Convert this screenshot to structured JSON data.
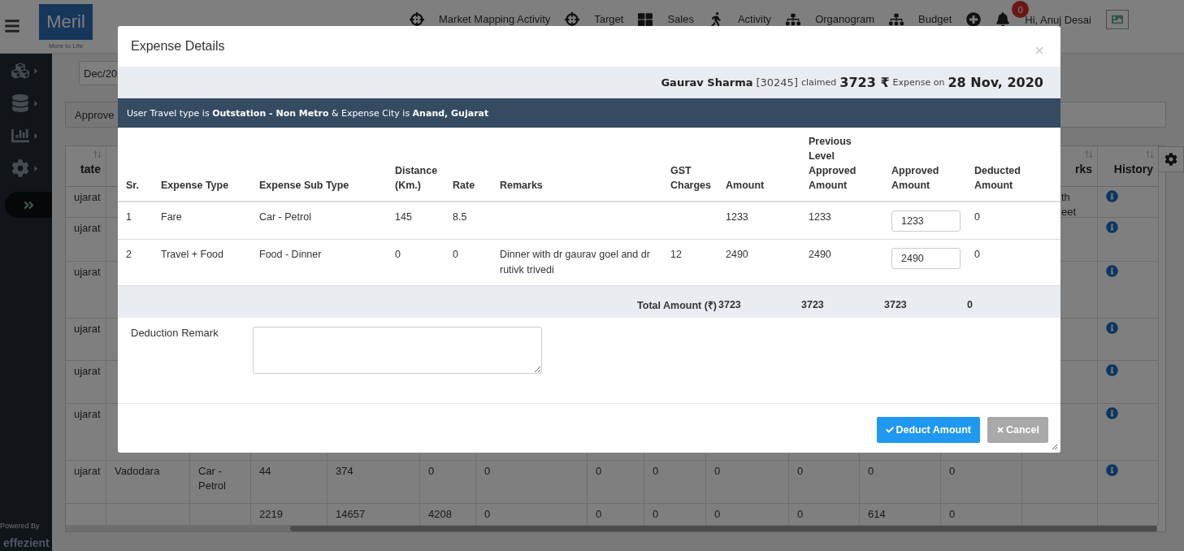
{
  "header": {
    "logo": "Meril",
    "tagline": "More to Life",
    "nav": [
      {
        "label": "Market Mapping Activity",
        "kind": "target"
      },
      {
        "label": "Target",
        "kind": "target"
      },
      {
        "label": "Sales",
        "kind": "sales"
      },
      {
        "label": "Activity",
        "kind": "activity"
      },
      {
        "label": "Organogram",
        "kind": "organogram"
      },
      {
        "label": "Budget",
        "kind": "organogram"
      }
    ],
    "notification_count": "0",
    "greeting": "Hi, Anuj Desai"
  },
  "sidebar": {
    "items": [
      {
        "kind": "cubes"
      },
      {
        "kind": "database"
      },
      {
        "kind": "chart"
      },
      {
        "kind": "settings"
      },
      {
        "kind": "expand"
      }
    ],
    "powered_by": "Powered By",
    "brand": "effezient"
  },
  "filter": {
    "period": "Dec/20"
  },
  "action_tab": "Approve",
  "background_table": {
    "headers": {
      "state": "tate",
      "remarks": "rks",
      "history": "History"
    },
    "rows": [
      {
        "kind": "partial",
        "state": "ujarat",
        "remarks": "th eet"
      },
      {
        "kind": "partial",
        "state": "ujarat"
      },
      {
        "kind": "partial",
        "state": "ujarat"
      },
      {
        "kind": "partial",
        "state": "ujarat"
      },
      {
        "kind": "partial",
        "state": "ujarat"
      },
      {
        "kind": "partial",
        "state": "ujarat"
      },
      {
        "kind": "entry",
        "cells": [
          "ujarat",
          "Vadodara",
          "Car - Petrol",
          "44",
          "374",
          "0",
          "0",
          "0",
          "0",
          "0",
          "0",
          "0",
          "0"
        ]
      },
      {
        "kind": "total",
        "values": [
          "2219",
          "14657",
          "4208",
          "0",
          "0",
          "0",
          "0",
          "0",
          "614",
          "0"
        ]
      }
    ]
  },
  "modal": {
    "title": "Expense Details",
    "close": "×",
    "summary": {
      "claimant": "Gaurav Sharma",
      "employee_id": "[30245]",
      "claimed_label": "claimed",
      "amount": "3723 ₹",
      "expense_label": "Expense on",
      "date": "28 Nov, 2020"
    },
    "travel_info": "User Travel type is **Outstation - Non Metro** & Expense City is **Anand, Gujarat**",
    "columns": [
      "Sr.",
      "Expense Type",
      "Expense Sub Type",
      "Distance (Km.)",
      "Rate",
      "Remarks",
      "GST Charges",
      "Amount",
      "Previous Level Approved Amount",
      "Approved Amount",
      "Deducted Amount"
    ],
    "rows": [
      {
        "sr": "1",
        "expense_type": "Fare",
        "sub_type": "Car - Petrol",
        "distance": "145",
        "rate": "8.5",
        "amount": "1233",
        "previous_approved": "1233",
        "approved": "1233",
        "deducted": "0"
      },
      {
        "sr": "2",
        "expense_type": "Travel + Food",
        "sub_type": "Food - Dinner",
        "distance": "0",
        "rate": "0",
        "remarks": "Dinner with dr gaurav goel and dr rutivk trivedi",
        "gst": "12",
        "amount": "2490",
        "previous_approved": "2490",
        "approved": "2490",
        "deducted": "0"
      }
    ],
    "total": {
      "label": "Total Amount (₹)",
      "amount": "3723",
      "previous_approved": "3723",
      "approved": "3723",
      "deducted": "0"
    },
    "deduction_remark": {
      "label": "Deduction Remark"
    },
    "buttons": [
      {
        "label": "Deduct Amount",
        "kind": "primary"
      },
      {
        "label": "Cancel",
        "kind": "secondary"
      }
    ]
  }
}
